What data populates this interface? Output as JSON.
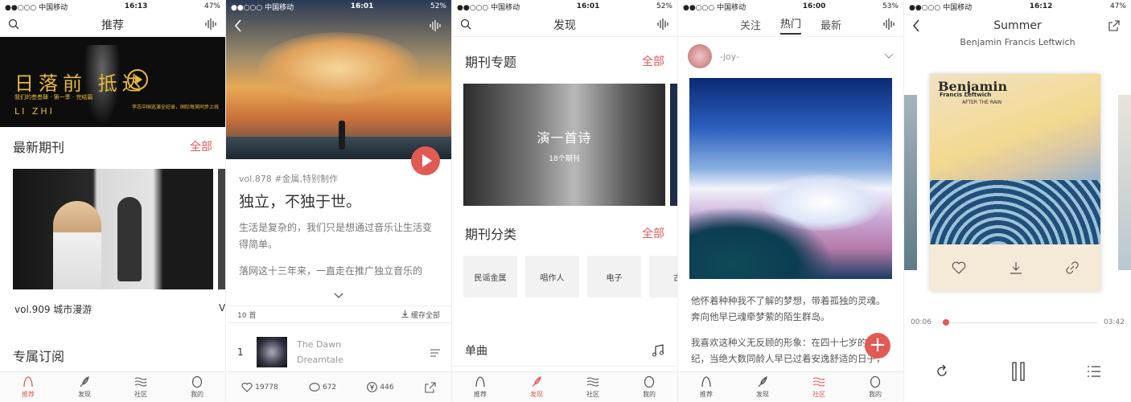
{
  "status": {
    "s1": {
      "carrier": "●●○○○ 中国移动",
      "time": "16:13",
      "battery": "47%"
    },
    "s2": {
      "carrier": "●●○○○ 中国移动",
      "time": "16:01",
      "battery": "52%"
    },
    "s3": {
      "carrier": "●●○○○ 中国移动",
      "time": "16:01",
      "battery": "52%"
    },
    "s4": {
      "carrier": "●●○○○ 中国移动",
      "time": "16:00",
      "battery": "53%"
    },
    "s5": {
      "carrier": "●●○○○ 中国移动",
      "time": "16:12",
      "battery": "47%"
    }
  },
  "tabs": [
    "推荐",
    "发现",
    "社区",
    "我的"
  ],
  "screen1": {
    "title": "推荐",
    "banner": {
      "title": "日落前 抵达",
      "subtitle": "我们的叁叁肆 · 第一季 · 完结篇",
      "name": "LI ZHI",
      "note": "李志中国巡演全纪录，国际每周同步上线"
    },
    "latest_title": "最新期刊",
    "more": "全部",
    "vol_caption": "vol.909 城市漫游",
    "vol_caption_peek": "Vo",
    "subscribe_title": "专属订阅"
  },
  "screen2": {
    "meta": "vol.878  #金属,特别制作",
    "title": "独立，不独于世。",
    "para1": "生活是复杂的，我们只是想通过音乐让生活变得简单。",
    "para2": "落网这十三年来，一直走在推广独立音乐的",
    "track_count": "10 首",
    "cache_all": "缓存全部",
    "track": {
      "num": "1",
      "title": "The Dawn",
      "artist": "Dreamtale"
    },
    "likes": "19778",
    "comments": "672",
    "coins": "446"
  },
  "screen3": {
    "title": "发现",
    "topics_title": "期刊专题",
    "more": "全部",
    "topic": {
      "name": "演一首诗",
      "count": "18个期刊"
    },
    "category_title": "期刊分类",
    "categories": [
      "民谣金属",
      "唱作人",
      "电子",
      "古"
    ],
    "single_title": "单曲"
  },
  "screen4": {
    "tabs": [
      "关注",
      "热门",
      "最新"
    ],
    "user": "-joy-",
    "p1": "他怀着种种我不了解的梦想，带着孤独的灵魂。奔向他早已魂牵梦萦的陌生群岛。",
    "p2": "我喜欢这种义无反顾的形象：在四十七岁的年纪，当绝大数同龄人早已过着安逸舒适的日子，他毅然去寻找新的世界。"
  },
  "screen5": {
    "song": "Summer",
    "artist": "Benjamin Francis Leftwich",
    "album_title": "Benjamin",
    "album_sub": "Francis Leftwich",
    "album_sub2": "AFTER THE RAIN",
    "elapsed": "00:06",
    "total": "03:42",
    "progress": 0.03
  },
  "colors": {
    "accent": "#e05a56"
  }
}
